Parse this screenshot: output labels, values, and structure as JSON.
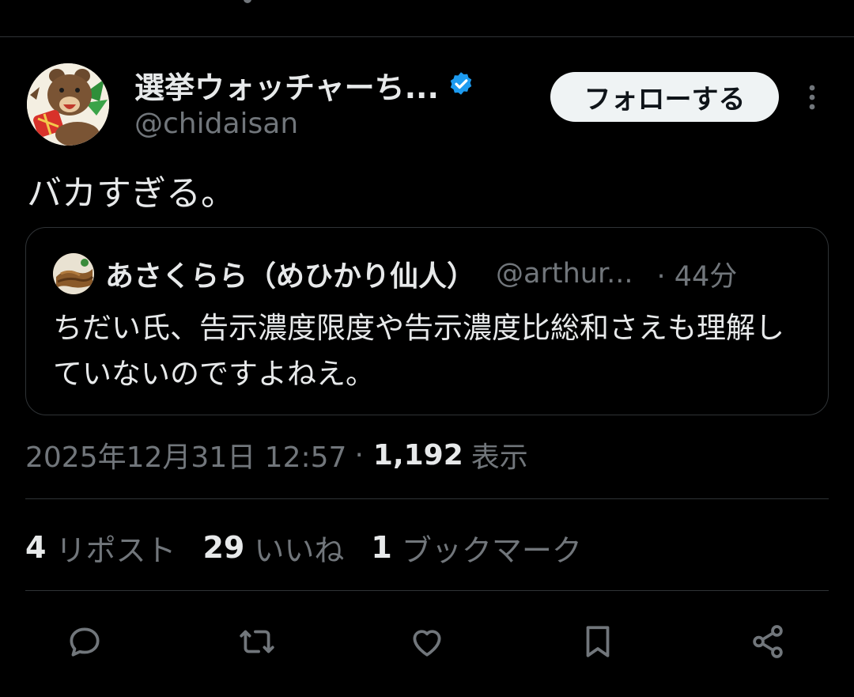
{
  "tweet": {
    "author_name": "選挙ウォッチャーち...",
    "author_handle": "@chidaisan",
    "follow_label": "フォローする",
    "text": "バカすぎる。",
    "timestamp": "2025年12月31日 12:57",
    "separator": "·",
    "views_count": "1,192",
    "views_label": "表示"
  },
  "quote": {
    "author_name": "あさくらら（めひかり仙人）",
    "handle": "@arthur...",
    "time": "· 44分",
    "text": "ちだい氏、告示濃度限度や告示濃度比総和さえも理解していないのですよねえ。"
  },
  "stats": [
    {
      "count": "4",
      "label": "リポスト"
    },
    {
      "count": "29",
      "label": "いいね"
    },
    {
      "count": "1",
      "label": "ブックマーク"
    }
  ],
  "actions": [
    "reply-icon",
    "retweet-icon",
    "like-icon",
    "bookmark-icon",
    "share-icon"
  ],
  "colors": {
    "background": "#000000",
    "text": "#e7e9ea",
    "secondary": "#71767b",
    "verified": "#1d9bf0",
    "follow_bg": "#eff3f4"
  }
}
